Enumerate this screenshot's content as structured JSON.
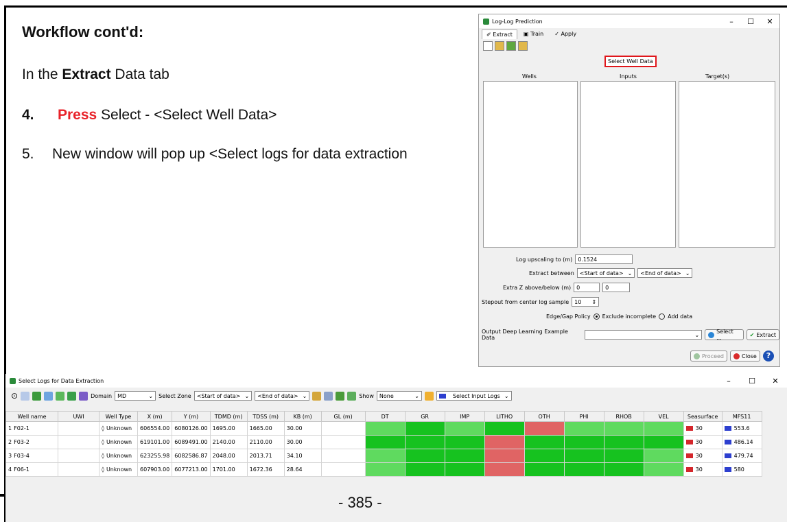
{
  "slide": {
    "heading": "Workflow cont'd:",
    "line1_pre": "In the ",
    "line1_bold": "Extract",
    "line1_post": " Data tab",
    "step4_num": "4.",
    "step4_press": "Press",
    "step4_rest": " Select - <Select Well Data>",
    "step5_num": "5.",
    "step5_text": "New window will pop up <Select logs for data extraction",
    "page_number": "- 385 -"
  },
  "loglog": {
    "title": "Log-Log Prediction",
    "tabs": [
      "Extract",
      "Train",
      "Apply"
    ],
    "select_well_label": "Select Well Data",
    "col_wells": "Wells",
    "col_inputs": "Inputs",
    "col_targets": "Target(s)",
    "upscale_label": "Log upscaling to (m)",
    "upscale_value": "0.1524",
    "extract_between_label": "Extract between",
    "extract_start": "<Start of data>",
    "extract_end": "<End of data>",
    "extra_z_label": "Extra Z above/below (m)",
    "extra_z_above": "0",
    "extra_z_below": "0",
    "stepout_label": "Stepout from center log sample",
    "stepout_value": "10",
    "edge_gap_label": "Edge/Gap Policy",
    "edge_opt1": "Exclude incomplete",
    "edge_opt2": "Add data",
    "output_label": "Output Deep Learning Example Data",
    "select_btn": "Select ...",
    "extract_btn": "Extract",
    "proceed_btn": "Proceed",
    "close_btn": "Close"
  },
  "selectlogs": {
    "title": "Select Logs for Data Extraction",
    "domain_label": "Domain",
    "domain_value": "MD",
    "select_zone_label": "Select Zone",
    "zone_start": "<Start of data>",
    "zone_end": "<End of data>",
    "show_label": "Show",
    "show_value": "None",
    "select_input_logs": "Select Input Logs",
    "headers": [
      "Well name",
      "UWI",
      "Well Type",
      "X (m)",
      "Y (m)",
      "TDMD (m)",
      "TDSS (m)",
      "KB (m)",
      "GL (m)",
      "DT",
      "GR",
      "IMP",
      "LITHO",
      "OTH",
      "PHI",
      "RHOB",
      "VEL",
      "Seasurface",
      "MFS11"
    ],
    "rows": [
      {
        "idx": "1",
        "name": "F02-1",
        "uwi": "",
        "type": "Unknown",
        "x": "606554.00",
        "y": "6080126.00",
        "tdmd": "1695.00",
        "tdss": "1665.00",
        "kb": "30.00",
        "gl": "",
        "logs": [
          "lg",
          "g",
          "lg",
          "g",
          "r",
          "lg",
          "lg",
          "lg"
        ],
        "sea": "30",
        "mfs": "553.6"
      },
      {
        "idx": "2",
        "name": "F03-2",
        "uwi": "",
        "type": "Unknown",
        "x": "619101.00",
        "y": "6089491.00",
        "tdmd": "2140.00",
        "tdss": "2110.00",
        "kb": "30.00",
        "gl": "",
        "logs": [
          "g",
          "g",
          "g",
          "r",
          "g",
          "g",
          "g",
          "g"
        ],
        "sea": "30",
        "mfs": "486.14"
      },
      {
        "idx": "3",
        "name": "F03-4",
        "uwi": "",
        "type": "Unknown",
        "x": "623255.98",
        "y": "6082586.87",
        "tdmd": "2048.00",
        "tdss": "2013.71",
        "kb": "34.10",
        "gl": "",
        "logs": [
          "lg",
          "g",
          "g",
          "r",
          "g",
          "g",
          "g",
          "lg"
        ],
        "sea": "30",
        "mfs": "479.74"
      },
      {
        "idx": "4",
        "name": "F06-1",
        "uwi": "",
        "type": "Unknown",
        "x": "607903.00",
        "y": "6077213.00",
        "tdmd": "1701.00",
        "tdss": "1672.36",
        "kb": "28.64",
        "gl": "",
        "logs": [
          "lg",
          "g",
          "g",
          "r",
          "g",
          "g",
          "g",
          "lg"
        ],
        "sea": "30",
        "mfs": "580"
      }
    ],
    "colors": {
      "dark_green": "#16c21f",
      "light_green": "#5fda5f",
      "red": "#e06464",
      "sea_marker": "#d4262b",
      "mfs_marker": "#2d3fcf"
    }
  }
}
